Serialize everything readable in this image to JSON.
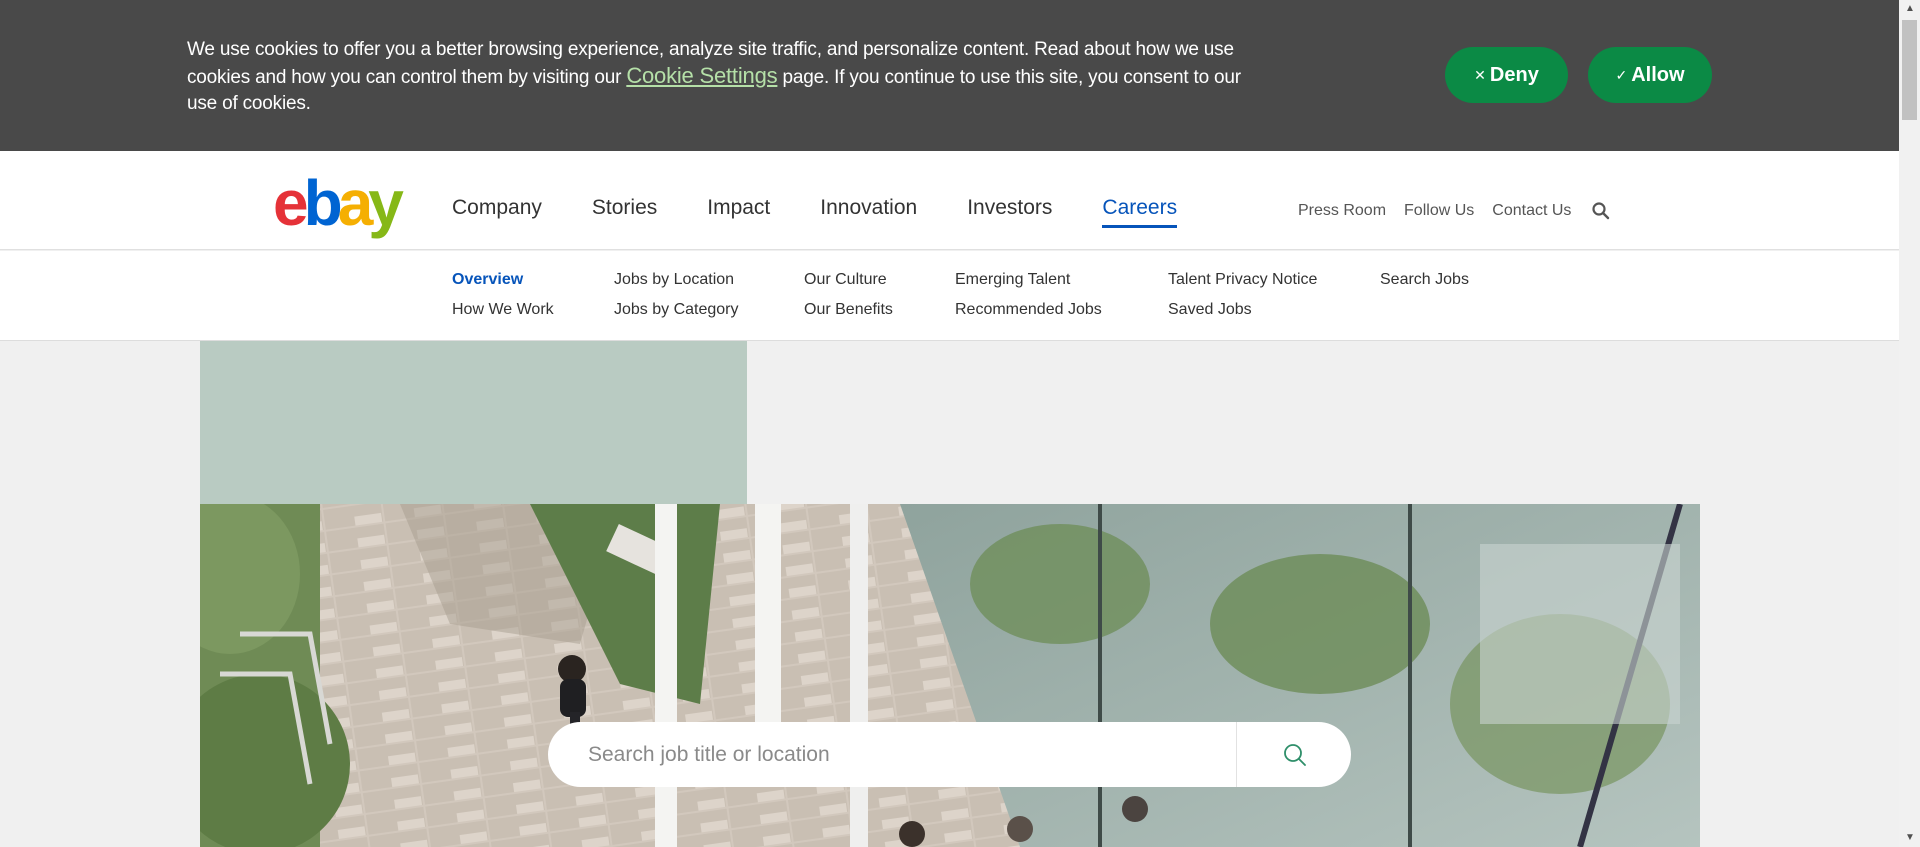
{
  "cookie_banner": {
    "text_before": "We use cookies to offer you a better browsing experience, analyze site traffic, and personalize content. Read about how we use cookies and how you can control them by visiting our ",
    "link": "Cookie Settings",
    "text_after": " page. If you continue to use this site, you consent to our use of cookies.",
    "deny_label": "Deny",
    "allow_label": "Allow"
  },
  "logo": {
    "e": "e",
    "b": "b",
    "a": "a",
    "y": "y"
  },
  "main_nav": [
    "Company",
    "Stories",
    "Impact",
    "Innovation",
    "Investors",
    "Careers"
  ],
  "main_nav_active": "Careers",
  "util_nav": [
    "Press Room",
    "Follow Us",
    "Contact Us"
  ],
  "sub_nav": {
    "overview": "Overview",
    "how_we_work": "How We Work",
    "jobs_by_location": "Jobs by Location",
    "jobs_by_category": "Jobs by Category",
    "our_culture": "Our Culture",
    "our_benefits": "Our Benefits",
    "emerging_talent": "Emerging Talent",
    "recommended_jobs": "Recommended Jobs",
    "talent_privacy_notice": "Talent Privacy Notice",
    "saved_jobs": "Saved Jobs",
    "search_jobs": "Search Jobs"
  },
  "job_search": {
    "placeholder": "Search job title or location"
  },
  "colors": {
    "banner_bg": "#494949",
    "button_green": "#0b8a45",
    "link_blue": "#0654ba",
    "hero_green": "#b9cbc2"
  },
  "icons": [
    "close-icon",
    "check-icon",
    "search-icon",
    "magnifier-icon"
  ]
}
